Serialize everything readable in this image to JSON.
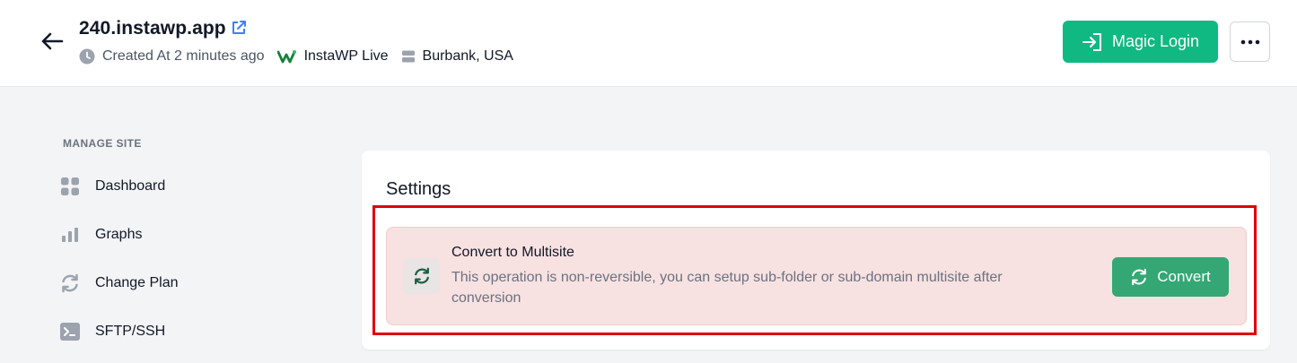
{
  "header": {
    "site_name": "240.instawp.app",
    "created": "Created At 2 minutes ago",
    "provider": "InstaWP Live",
    "location": "Burbank, USA",
    "magic_login_label": "Magic Login"
  },
  "sidebar": {
    "section_label": "MANAGE SITE",
    "items": [
      {
        "label": "Dashboard",
        "icon": "grid-icon"
      },
      {
        "label": "Graphs",
        "icon": "bar-chart-icon"
      },
      {
        "label": "Change Plan",
        "icon": "refresh-icon"
      },
      {
        "label": "SFTP/SSH",
        "icon": "terminal-icon"
      }
    ]
  },
  "settings": {
    "title": "Settings",
    "multisite": {
      "title": "Convert to Multisite",
      "description": "This operation is non-reversible, you can setup sub-folder or sub-domain multisite after conversion",
      "button_label": "Convert"
    }
  },
  "colors": {
    "primary_green": "#10b981",
    "convert_green": "#34a774",
    "warning_bg": "#f8e1e1",
    "highlight_red": "#e00000"
  }
}
